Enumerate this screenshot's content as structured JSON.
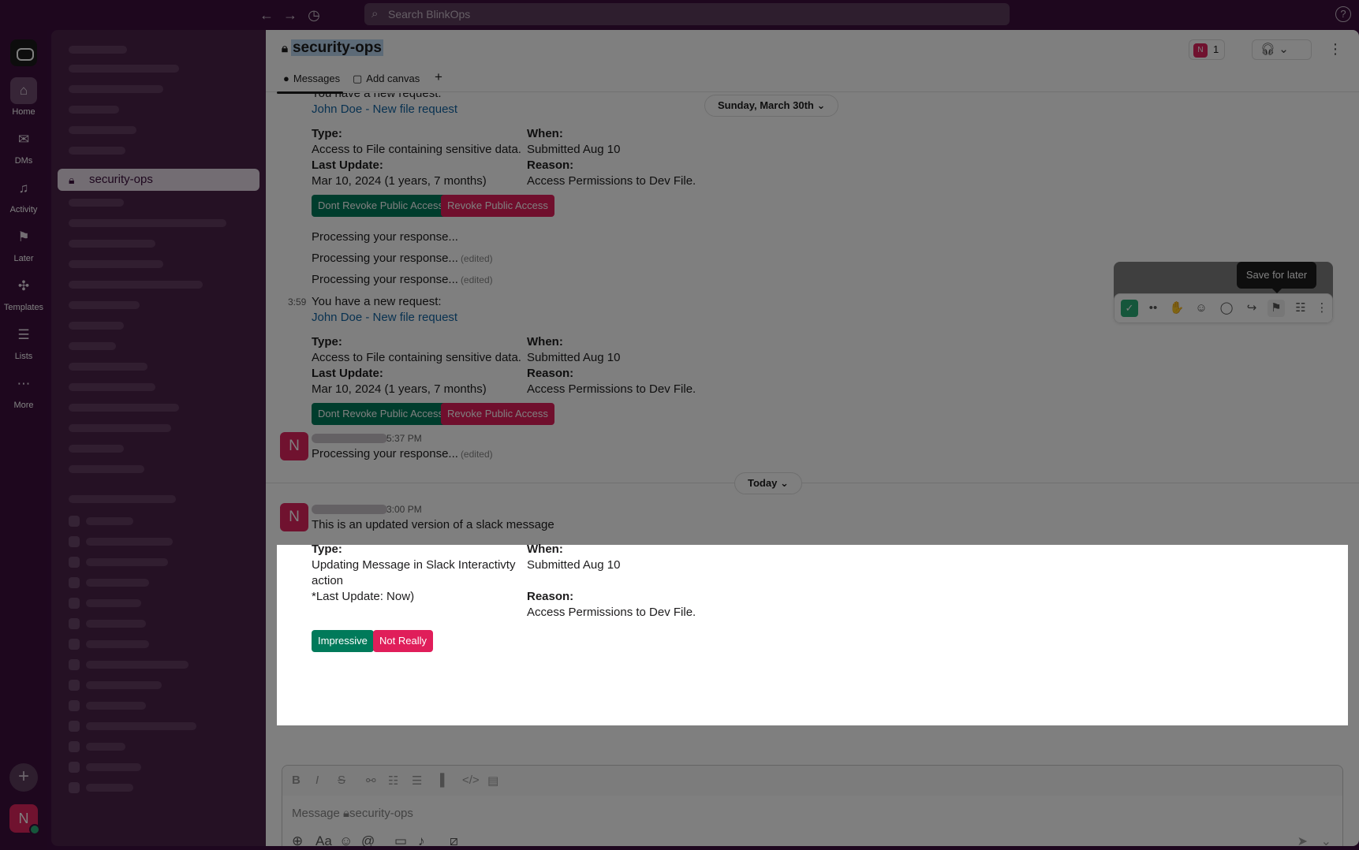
{
  "search": {
    "placeholder": "Search BlinkOps"
  },
  "rail": {
    "items": [
      {
        "label": "Home"
      },
      {
        "label": "DMs"
      },
      {
        "label": "Activity"
      },
      {
        "label": "Later"
      },
      {
        "label": "Templates"
      },
      {
        "label": "Lists"
      },
      {
        "label": "More"
      }
    ],
    "avatar_initial": "N"
  },
  "sidebar": {
    "active_channel": "security-ops"
  },
  "header": {
    "channel_name": "security-ops",
    "member_initial": "N",
    "member_count": "1"
  },
  "tabs": [
    {
      "label": "Messages"
    },
    {
      "label": "Add canvas"
    }
  ],
  "date_dividers": {
    "previous": "Sunday, March 30th",
    "today": "Today"
  },
  "messages": {
    "request1": {
      "intro": "You have a new request:",
      "link": "John Doe - New file request",
      "type_label": "Type:",
      "type_value": "Access to File containing sensitive data.",
      "last_update_label": "Last Update:",
      "last_update_value": "Mar 10, 2024 (1 years, 7 months)",
      "when_label": "When:",
      "when_value": "Submitted Aug 10",
      "reason_label": "Reason:",
      "reason_value": "Access Permissions to Dev File.",
      "btn_keep": "Dont Revoke Public Access",
      "btn_revoke": "Revoke Public Access"
    },
    "processing": [
      "Processing your response...",
      "Processing your response...",
      "Processing your response..."
    ],
    "edited": "(edited)",
    "request2": {
      "time": "3:59",
      "intro": "You have a new request:",
      "link": "John Doe - New file request",
      "type_label": "Type:",
      "type_value": "Access to File containing sensitive data.",
      "last_update_label": "Last Update:",
      "last_update_value": "Mar 10, 2024 (1 years, 7 months)",
      "when_label": "When:",
      "when_value": "Submitted Aug 10",
      "reason_label": "Reason:",
      "reason_value": "Access Permissions to Dev File.",
      "btn_keep": "Dont Revoke Public Access",
      "btn_revoke": "Revoke Public Access"
    },
    "user_processing": {
      "initial": "N",
      "time": "5:37 PM",
      "text": "Processing your response..."
    },
    "latest": {
      "initial": "N",
      "time": "3:00 PM",
      "text": "This is an updated version of a slack message",
      "type_label": "Type:",
      "type_value_1": "Updating Message in Slack Interactivty",
      "type_value_2": "action",
      "last_update": "*Last Update: Now)",
      "when_label": "When:",
      "when_value": "Submitted Aug 10",
      "reason_label": "Reason:",
      "reason_value": "Access Permissions to Dev File.",
      "btn_yes": "Impressive",
      "btn_no": "Not Really"
    }
  },
  "tooltip": "Save for later",
  "composer": {
    "placeholder": "Message",
    "channel": "security-ops"
  }
}
